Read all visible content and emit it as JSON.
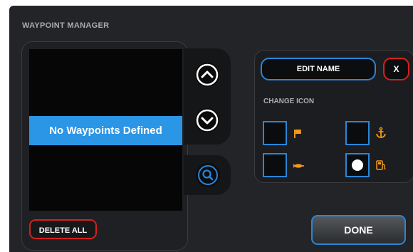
{
  "title": "WAYPOINT MANAGER",
  "list": {
    "empty_message": "No Waypoints Defined"
  },
  "buttons": {
    "delete_all": "DELETE ALL",
    "edit_name": "EDIT NAME",
    "close": "X",
    "done": "DONE"
  },
  "change_icon_label": "CHANGE ICON",
  "icon_options": [
    {
      "icon": "flag-icon",
      "color": "#f39a1b",
      "selected": false
    },
    {
      "icon": "anchor-icon",
      "color": "#f39a1b",
      "selected": false
    },
    {
      "icon": "fish-icon",
      "color": "#f39a1b",
      "selected": false
    },
    {
      "icon": "fuel-pump-icon",
      "color": "#f39a1b",
      "selected": true
    }
  ],
  "colors": {
    "accent": "#2a86d8",
    "highlight": "#2b95e6",
    "danger": "#d61f1f",
    "icon": "#f39a1b"
  }
}
